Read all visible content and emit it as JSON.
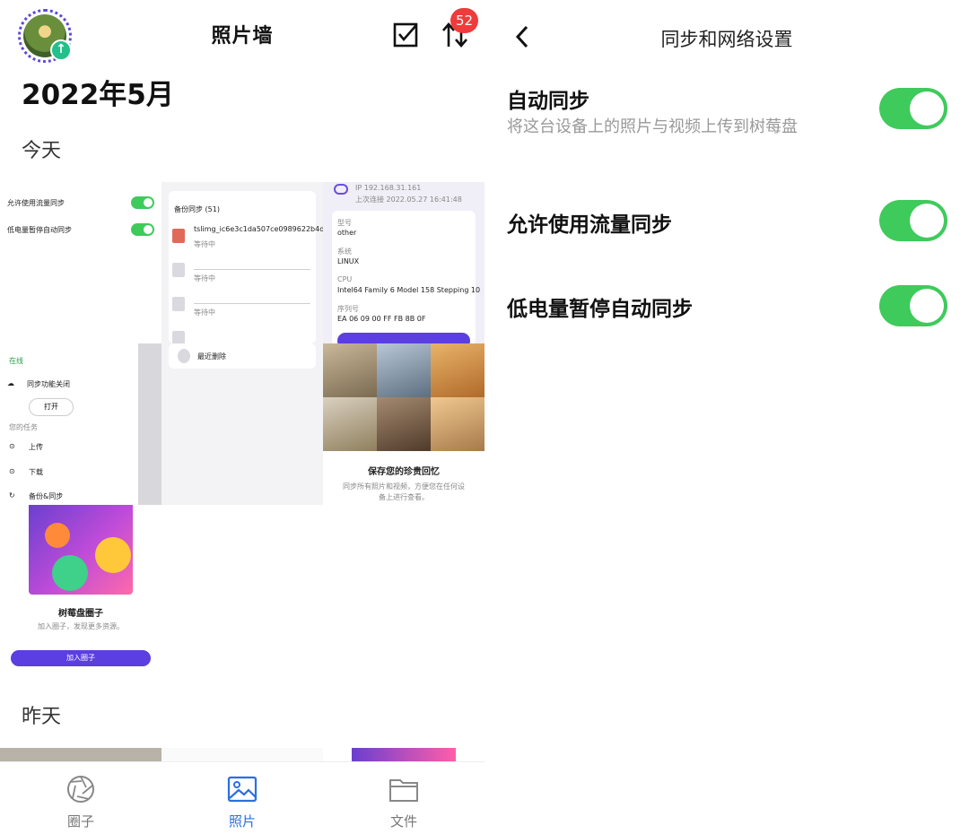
{
  "left": {
    "title": "照片墙",
    "badge_count": "52",
    "month": "2022年5月",
    "sections": {
      "today": "今天",
      "yesterday": "昨天"
    },
    "icons": [
      "avatar",
      "upload-icon",
      "select-checkbox-icon",
      "transfer-arrows-icon"
    ],
    "thumb_settings": {
      "row1": "允许使用流量同步",
      "row2": "低电量暂停自动同步"
    },
    "thumb_backup": {
      "header": "备份同步 (51)",
      "file_name": "tslimg_ic6e3c1da507ce0989622b4d...",
      "status": "等待中",
      "recent": "最近删除"
    },
    "thumb_device": {
      "ip": "IP 192.168.31.161",
      "last_online": "上次连接 2022.05.27 16:41:48",
      "model_label": "型号",
      "model_value": "other",
      "system_label": "系统",
      "system_value": "LINUX",
      "cpu_label": "CPU",
      "cpu_value": "Intel64 Family 6 Model 158 Stepping 10",
      "serial_label": "序列号",
      "serial_value": "EA 06 09 00 FF FB 8B 0F"
    },
    "thumb_menu": {
      "online": "在线",
      "sync_label": "同步功能关闭",
      "open_btn": "打开",
      "section": "您的任务",
      "upload": "上传",
      "download": "下载",
      "backup": "备份&同步"
    },
    "thumb_memories": {
      "title": "保存您的珍贵回忆",
      "desc1": "同步所有照片和视频，方便您在任何设",
      "desc2": "备上进行查看。"
    },
    "thumb_circle": {
      "title": "树莓盘圈子",
      "desc": "加入圈子，发现更多资源。",
      "button": "加入圈子"
    },
    "nav": [
      {
        "label": "圈子",
        "icon": "aperture-icon"
      },
      {
        "label": "照片",
        "icon": "image-icon"
      },
      {
        "label": "文件",
        "icon": "folder-icon"
      }
    ],
    "colors": {
      "accent": "#2b6fe0",
      "badge": "#ef3b3b",
      "avatar_ring": "#5b4bd8"
    }
  },
  "right": {
    "title": "同步和网络设置",
    "settings": [
      {
        "label": "自动同步",
        "desc": "将这台设备上的照片与视频上传到树莓盘",
        "on": true
      },
      {
        "label": "允许使用流量同步",
        "desc": "",
        "on": true
      },
      {
        "label": "低电量暂停自动同步",
        "desc": "",
        "on": true
      }
    ],
    "colors": {
      "toggle_on": "#3fca5c"
    }
  }
}
